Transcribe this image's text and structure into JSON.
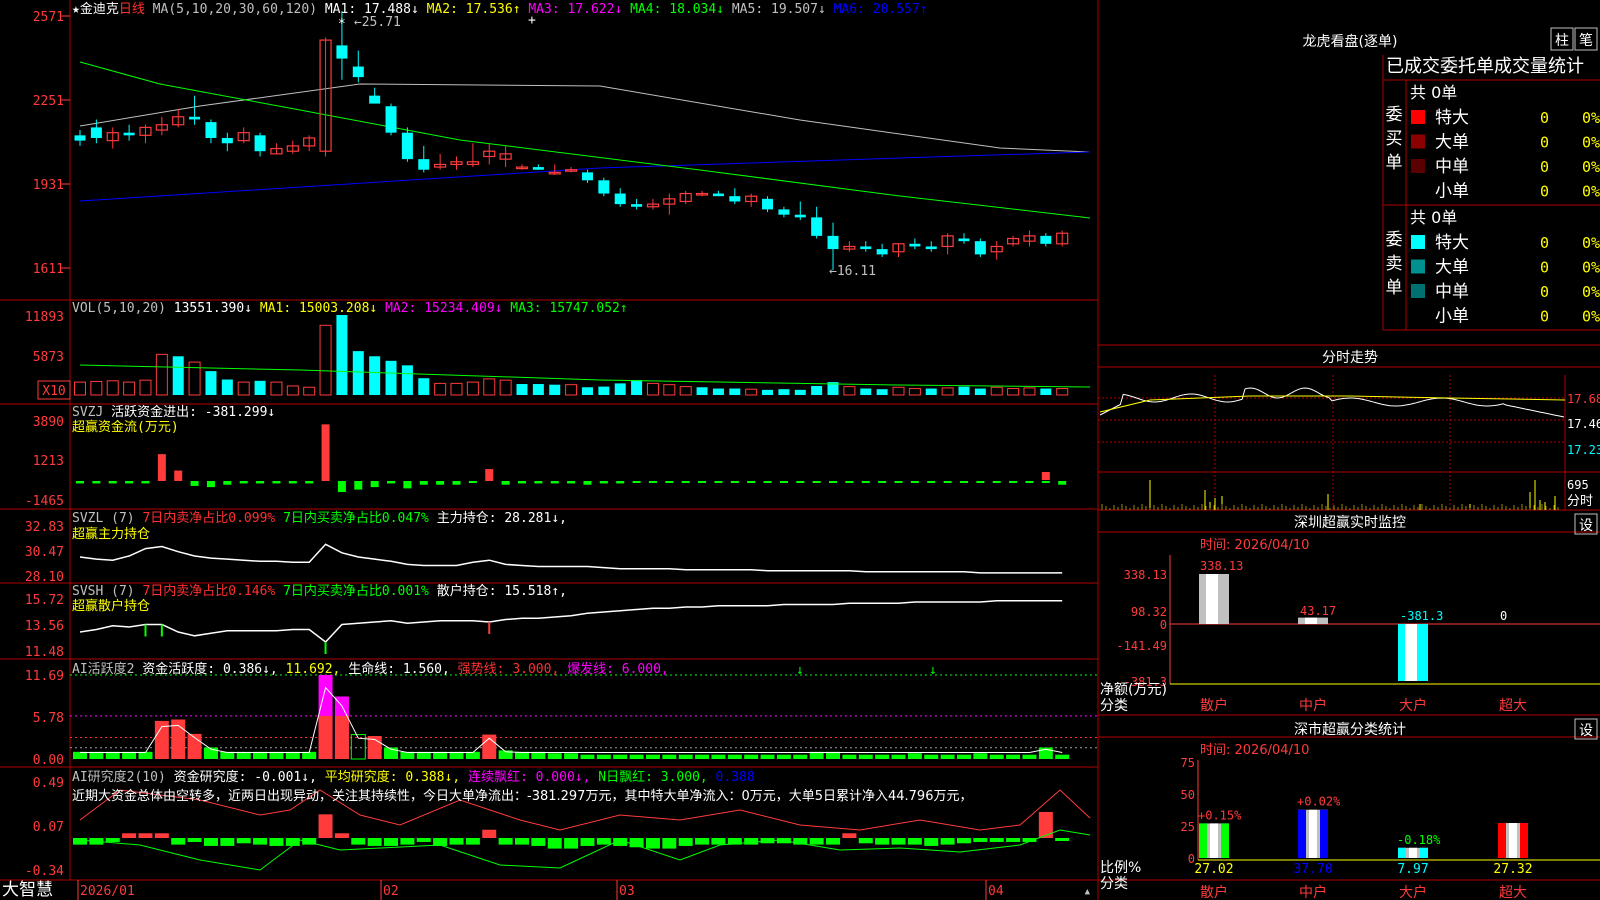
{
  "app": {
    "brand": "大智慧",
    "ai_commentary": "近期大资金总体由空转多，近两日出现异动，关注其持续性，今日大单净流出：-381.297万元，其中特大单净流入：0万元，大单5日累计净入44.796万元，"
  },
  "colors": {
    "up": "#ff3b3b",
    "down": "#00ffff",
    "bg": "#000000",
    "frame": "#b00000",
    "text": "#c0c0c0",
    "ma1": "#ffffff",
    "ma2": "#ffff00",
    "ma3": "#ff00ff",
    "ma4": "#00ff00",
    "ma5": "#c0c0c0",
    "ma6": "#0000ff",
    "green": "#00ff00",
    "yellow": "#ffff00",
    "magenta": "#ff00ff",
    "red": "#ff3030",
    "gray": "#c0c0c0"
  },
  "headers": {
    "kline": [
      {
        "text": "★金迪克",
        "c": "#ffffff"
      },
      {
        "text": "日线",
        "c": "#ff3030"
      },
      {
        "text": " MA(5,10,20,30,60,120)",
        "c": "#c0c0c0"
      },
      {
        "text": " MA1: 17.488↓",
        "c": "#ffffff"
      },
      {
        "text": " MA2: 17.536↑",
        "c": "#ffff00"
      },
      {
        "text": " MA3: 17.622↓",
        "c": "#ff00ff"
      },
      {
        "text": " MA4: 18.034↓",
        "c": "#00ff00"
      },
      {
        "text": " MA5: 19.507↓",
        "c": "#c0c0c0"
      },
      {
        "text": " MA6: 20.557↑",
        "c": "#0000ff"
      }
    ],
    "vol": [
      {
        "text": "VOL(5,10,20)",
        "c": "#c0c0c0"
      },
      {
        "text": " 13551.390↓",
        "c": "#ffffff"
      },
      {
        "text": " MA1: 15003.208↓",
        "c": "#ffff00"
      },
      {
        "text": " MA2: 15234.409↓",
        "c": "#ff00ff"
      },
      {
        "text": " MA3: 15747.052↑",
        "c": "#00ff00"
      }
    ],
    "svzj": [
      {
        "text": "SVZJ",
        "c": "#c0c0c0"
      },
      {
        "text": "  活跃资金进出: -381.299↓",
        "c": "#ffffff"
      }
    ],
    "svzj2": [
      {
        "text": "超赢资金流(万元)",
        "c": "#ffff00"
      }
    ],
    "svzl": [
      {
        "text": "SVZL (7)",
        "c": "#c0c0c0"
      },
      {
        "text": " 7日内卖净占比0.099%",
        "c": "#ff3030"
      },
      {
        "text": " 7日内买卖净占比0.047%",
        "c": "#00ff00"
      },
      {
        "text": " 主力持仓: 28.281↓,",
        "c": "#ffffff"
      }
    ],
    "svzl2": [
      {
        "text": "超赢主力持仓",
        "c": "#ffff00"
      }
    ],
    "svsh": [
      {
        "text": "SVSH (7)",
        "c": "#c0c0c0"
      },
      {
        "text": " 7日内卖净占比0.146%",
        "c": "#ff3030"
      },
      {
        "text": " 7日内买卖净占比0.001%",
        "c": "#00ff00"
      },
      {
        "text": " 散户持仓: 15.518↑,",
        "c": "#ffffff"
      }
    ],
    "svsh2": [
      {
        "text": "超赢散户持仓",
        "c": "#ffff00"
      }
    ],
    "ai1": [
      {
        "text": "AI活跃度2",
        "c": "#c0c0c0"
      },
      {
        "text": " 资金活跃度: 0.386↓,",
        "c": "#ffffff"
      },
      {
        "text": " 11.692,",
        "c": "#ffff00"
      },
      {
        "text": " 生命线: 1.560,",
        "c": "#ffffff"
      },
      {
        "text": " 强势线: 3.000,",
        "c": "#ff3030"
      },
      {
        "text": " 爆发线: 6.000,",
        "c": "#ff00ff"
      }
    ],
    "ai2": [
      {
        "text": "AI研究度2(10)",
        "c": "#c0c0c0"
      },
      {
        "text": " 资金研究度: -0.001↓,",
        "c": "#ffffff"
      },
      {
        "text": " 平均研究度: 0.388↓,",
        "c": "#ffff00"
      },
      {
        "text": " 连续飘红: 0.000↓,",
        "c": "#ff00ff"
      },
      {
        "text": " N日飘红: 3.000,",
        "c": "#00ff00"
      },
      {
        "text": " 0.388",
        "c": "#0000ff"
      }
    ]
  },
  "axes": {
    "kline": [
      "2571",
      "2251",
      "1931",
      "1611"
    ],
    "vol": [
      "11893",
      "5873"
    ],
    "vol_unit": "X10",
    "svzj": [
      "3890",
      "1213",
      "-1465"
    ],
    "svzl": [
      "32.83",
      "30.47",
      "28.10"
    ],
    "svsh": [
      "15.72",
      "13.56",
      "11.48"
    ],
    "ai1": [
      "11.69",
      "5.78",
      "0.00"
    ],
    "ai2": [
      "0.49",
      "0.07",
      "-0.34"
    ],
    "dates": [
      "2026/01",
      "02",
      "03",
      "04"
    ],
    "intraday_right": [
      "17.68",
      "17.46",
      "17.23",
      "695"
    ],
    "intraday_right_last": "分时"
  },
  "kline_labels": {
    "high": "25.71",
    "low": "16.11"
  },
  "right_panel": {
    "longhu_title": "龙虎看盘(逐单)",
    "btn_zhu": "柱",
    "btn_bi": "笔",
    "tabs_line": "已成交委托单成交量统计",
    "buy_group": {
      "title": "委买单",
      "total": "共 0单",
      "rows": [
        {
          "label": "特大",
          "v": "0",
          "p": "0%",
          "c": "#ff0000"
        },
        {
          "label": "大单",
          "v": "0",
          "p": "0%",
          "c": "#8b0000"
        },
        {
          "label": "中单",
          "v": "0",
          "p": "0%",
          "c": "#5a0000"
        },
        {
          "label": "小单",
          "v": "0",
          "p": "0%",
          "c": ""
        }
      ]
    },
    "sell_group": {
      "title": "委卖单",
      "total": "共 0单",
      "rows": [
        {
          "label": "特大",
          "v": "0",
          "p": "0%",
          "c": "#00ffff"
        },
        {
          "label": "大单",
          "v": "0",
          "p": "0%",
          "c": "#009090"
        },
        {
          "label": "中单",
          "v": "0",
          "p": "0%",
          "c": "#007070"
        },
        {
          "label": "小单",
          "v": "0",
          "p": "0%",
          "c": ""
        }
      ]
    },
    "intraday_title": "分时走势",
    "monitor_title": "深圳超赢实时监控",
    "monitor_btn": "设",
    "monitor_time": "时间: 2026/04/10",
    "monitor_axis": [
      "338.13",
      "98.32",
      "0",
      "-141.49",
      "-381.3"
    ],
    "monitor_labels": [
      "338.13",
      "43.17",
      "-381.3",
      "0"
    ],
    "monitor_ylabel": "净额(万元)",
    "monitor_xlabel": "分类",
    "monitor_cats": [
      "散户",
      "中户",
      "大户",
      "超大"
    ],
    "class_title": "深市超赢分类统计",
    "class_btn": "设",
    "class_time": "时间: 2026/04/10",
    "class_axis": [
      "75",
      "50",
      "25",
      "0"
    ],
    "class_top": [
      "+0.15%",
      "+0.02%",
      "-0.18%",
      ""
    ],
    "class_bottom": [
      "27.02",
      "37.70",
      "7.97",
      "27.32"
    ],
    "class_ylabel": "比例%",
    "class_xlabel": "分类",
    "class_cats": [
      "散户",
      "中户",
      "大户",
      "超大"
    ]
  },
  "chart_data": [
    {
      "type": "candlestick",
      "title": "金迪克 日线",
      "y_ticks": [
        25.71,
        22.51,
        19.31,
        16.11
      ],
      "high_label": 25.71,
      "low_label": 16.11,
      "ohlc": [
        [
          21.2,
          21.4,
          20.8,
          21.0
        ],
        [
          21.5,
          21.8,
          20.9,
          21.1
        ],
        [
          21.0,
          21.5,
          20.7,
          21.3
        ],
        [
          21.3,
          21.6,
          21.0,
          21.2
        ],
        [
          21.2,
          21.6,
          20.9,
          21.5
        ],
        [
          21.4,
          21.9,
          21.2,
          21.6
        ],
        [
          21.6,
          22.2,
          21.5,
          21.9
        ],
        [
          21.9,
          22.7,
          21.6,
          21.8
        ],
        [
          21.7,
          21.8,
          20.9,
          21.1
        ],
        [
          21.1,
          21.3,
          20.6,
          20.9
        ],
        [
          21.0,
          21.5,
          20.9,
          21.3
        ],
        [
          21.2,
          21.3,
          20.4,
          20.6
        ],
        [
          20.5,
          20.9,
          20.5,
          20.7
        ],
        [
          20.6,
          21.0,
          20.5,
          20.8
        ],
        [
          20.8,
          21.2,
          20.6,
          21.1
        ],
        [
          20.6,
          24.9,
          20.4,
          24.8
        ],
        [
          24.6,
          25.9,
          23.3,
          24.1
        ],
        [
          23.8,
          24.4,
          23.2,
          23.4
        ],
        [
          22.7,
          23.0,
          22.4,
          22.4
        ],
        [
          22.3,
          22.4,
          21.2,
          21.3
        ],
        [
          21.3,
          21.5,
          20.2,
          20.3
        ],
        [
          20.3,
          20.8,
          19.8,
          19.9
        ],
        [
          20.0,
          20.5,
          19.9,
          20.1
        ],
        [
          20.1,
          20.4,
          19.9,
          20.2
        ],
        [
          20.1,
          20.9,
          20.0,
          20.2
        ],
        [
          20.4,
          20.9,
          20.1,
          20.6
        ],
        [
          20.3,
          20.8,
          20.0,
          20.5
        ],
        [
          20.0,
          20.1,
          19.9,
          20.0
        ],
        [
          20.0,
          20.1,
          19.9,
          19.9
        ],
        [
          19.8,
          20.1,
          19.7,
          19.8
        ],
        [
          19.9,
          20.0,
          19.8,
          19.9
        ],
        [
          19.8,
          19.9,
          19.4,
          19.5
        ],
        [
          19.5,
          19.6,
          18.9,
          19.0
        ],
        [
          19.0,
          19.2,
          18.5,
          18.6
        ],
        [
          18.6,
          18.8,
          18.4,
          18.5
        ],
        [
          18.5,
          18.8,
          18.4,
          18.6
        ],
        [
          18.6,
          19.0,
          18.2,
          18.8
        ],
        [
          18.7,
          19.1,
          18.6,
          19.0
        ],
        [
          19.0,
          19.1,
          18.9,
          19.0
        ],
        [
          19.0,
          19.1,
          18.9,
          18.9
        ],
        [
          18.9,
          19.2,
          18.6,
          18.7
        ],
        [
          18.7,
          19.0,
          18.5,
          18.9
        ],
        [
          18.8,
          18.9,
          18.3,
          18.4
        ],
        [
          18.4,
          18.5,
          18.1,
          18.2
        ],
        [
          18.2,
          18.7,
          18.0,
          18.1
        ],
        [
          18.1,
          18.5,
          17.3,
          17.4
        ],
        [
          17.4,
          17.9,
          16.1,
          16.9
        ],
        [
          16.9,
          17.2,
          16.8,
          17.0
        ],
        [
          17.0,
          17.2,
          16.8,
          16.9
        ],
        [
          16.9,
          17.1,
          16.6,
          16.7
        ],
        [
          16.8,
          17.1,
          16.6,
          17.1
        ],
        [
          17.1,
          17.3,
          16.9,
          17.0
        ],
        [
          17.0,
          17.2,
          16.8,
          16.9
        ],
        [
          17.0,
          17.5,
          16.7,
          17.4
        ],
        [
          17.3,
          17.5,
          17.1,
          17.2
        ],
        [
          17.2,
          17.3,
          16.6,
          16.7
        ],
        [
          16.8,
          17.2,
          16.5,
          17.0
        ],
        [
          17.1,
          17.4,
          17.0,
          17.3
        ],
        [
          17.2,
          17.6,
          17.0,
          17.4
        ],
        [
          17.4,
          17.5,
          17.0,
          17.1
        ],
        [
          17.1,
          17.6,
          17.0,
          17.5
        ]
      ]
    },
    {
      "type": "bar",
      "title": "VOL(5,10,20)",
      "unit": "X10",
      "y_ticks": [
        11893,
        5873
      ],
      "values": [
        2000,
        2100,
        2200,
        2000,
        2300,
        6300,
        6000,
        5100,
        3700,
        2400,
        2000,
        2200,
        2000,
        1400,
        1200,
        10800,
        12400,
        6800,
        6000,
        5300,
        4600,
        2600,
        1800,
        1800,
        2000,
        2500,
        2300,
        1700,
        1700,
        1600,
        1600,
        1200,
        1300,
        1800,
        2300,
        1800,
        1600,
        1300,
        1200,
        1000,
        1000,
        900,
        800,
        900,
        800,
        1400,
        2000,
        1300,
        1000,
        900,
        1200,
        1000,
        1000,
        1100,
        1300,
        1000,
        1200,
        1000,
        1100,
        1000,
        1000
      ],
      "up": [
        1,
        1,
        1,
        1,
        1,
        1,
        0,
        1,
        0,
        0,
        1,
        0,
        1,
        1,
        1,
        1,
        0,
        0,
        0,
        0,
        0,
        0,
        1,
        1,
        1,
        1,
        1,
        0,
        0,
        0,
        1,
        0,
        0,
        0,
        0,
        1,
        1,
        1,
        0,
        0,
        0,
        1,
        0,
        0,
        0,
        0,
        0,
        1,
        0,
        0,
        1,
        1,
        0,
        1,
        0,
        0,
        1,
        1,
        1,
        0,
        1
      ]
    },
    {
      "type": "bar",
      "title": "超赢资金流(万元)",
      "y_ticks": [
        3890,
        1213,
        -1465
      ],
      "values": [
        -200,
        -200,
        -200,
        -200,
        -200,
        1800,
        700,
        -400,
        -500,
        -300,
        -200,
        -200,
        -200,
        -200,
        -200,
        3800,
        -900,
        -700,
        -500,
        -200,
        -600,
        -300,
        -300,
        -300,
        -100,
        800,
        -300,
        -200,
        -200,
        -200,
        -200,
        -300,
        -200,
        -200,
        -100,
        -100,
        -100,
        -100,
        -100,
        -100,
        -100,
        -100,
        -100,
        -100,
        -100,
        -100,
        -100,
        -100,
        -100,
        -100,
        -100,
        -100,
        -100,
        -100,
        -100,
        -100,
        -100,
        -100,
        -100,
        -100,
        -300
      ],
      "last_red": 400
    },
    {
      "type": "line",
      "title": "超赢主力持仓",
      "y_ticks": [
        32.83,
        30.47,
        28.1
      ],
      "values": [
        29.8,
        29.6,
        29.5,
        29.9,
        30.6,
        30.8,
        30.3,
        29.9,
        29.7,
        29.6,
        29.5,
        29.4,
        29.4,
        29.3,
        29.3,
        31.0,
        30.2,
        29.8,
        29.6,
        29.4,
        29.1,
        29.0,
        29.0,
        29.0,
        29.3,
        29.5,
        29.1,
        29.0,
        28.9,
        28.9,
        28.9,
        28.9,
        28.8,
        28.7,
        28.7,
        28.7,
        28.7,
        28.6,
        28.6,
        28.6,
        28.6,
        28.6,
        28.5,
        28.5,
        28.5,
        28.5,
        28.5,
        28.5,
        28.4,
        28.4,
        28.4,
        28.4,
        28.4,
        28.4,
        28.4,
        28.3,
        28.3,
        28.3,
        28.3,
        28.3,
        28.3
      ]
    },
    {
      "type": "line",
      "title": "超赢散户持仓",
      "y_ticks": [
        15.72,
        13.56,
        11.48
      ],
      "values": [
        13.0,
        13.2,
        13.5,
        13.4,
        13.6,
        13.6,
        13.0,
        12.7,
        12.9,
        13.1,
        13.1,
        13.1,
        13.1,
        13.2,
        13.2,
        12.2,
        13.6,
        13.7,
        13.8,
        13.9,
        13.7,
        13.8,
        13.9,
        13.9,
        13.9,
        13.8,
        14.0,
        14.1,
        14.1,
        14.2,
        14.3,
        14.5,
        14.6,
        14.7,
        14.8,
        14.9,
        14.9,
        15.0,
        15.0,
        15.1,
        15.1,
        15.1,
        15.1,
        15.2,
        15.2,
        15.2,
        15.2,
        15.3,
        15.3,
        15.3,
        15.3,
        15.4,
        15.4,
        15.4,
        15.4,
        15.4,
        15.5,
        15.5,
        15.5,
        15.5,
        15.5
      ]
    },
    {
      "type": "bar",
      "title": "AI活跃度2",
      "y_ticks": [
        11.69,
        5.78,
        0.0
      ],
      "values": [
        1.0,
        1.0,
        1.0,
        1.0,
        1.0,
        5.3,
        5.5,
        3.5,
        1.6,
        1.0,
        1.0,
        1.0,
        1.0,
        1.0,
        1.0,
        11.7,
        8.7,
        3.4,
        3.2,
        1.6,
        1.0,
        1.0,
        1.0,
        1.0,
        1.0,
        3.4,
        1.2,
        1.0,
        1.0,
        0.8,
        0.8,
        0.6,
        0.6,
        0.6,
        0.6,
        0.6,
        0.6,
        0.6,
        0.6,
        0.6,
        0.6,
        0.6,
        0.6,
        0.6,
        0.6,
        1.0,
        1.0,
        0.6,
        0.6,
        0.6,
        0.6,
        0.8,
        0.6,
        0.6,
        0.6,
        0.8,
        0.6,
        0.6,
        0.6,
        1.6,
        0.6
      ],
      "lines": {
        "red": 3.0,
        "magenta": 6.0,
        "green": 11.69
      }
    },
    {
      "type": "bar",
      "title": "AI研究度2(10)",
      "y_ticks": [
        0.49,
        0.07,
        -0.34
      ],
      "values": [
        -0.05,
        -0.05,
        -0.03,
        0.04,
        0.04,
        0.04,
        -0.05,
        -0.03,
        -0.06,
        -0.06,
        -0.04,
        -0.05,
        -0.06,
        -0.06,
        -0.05,
        0.2,
        0.04,
        -0.05,
        -0.06,
        -0.06,
        -0.05,
        -0.03,
        -0.06,
        -0.05,
        -0.05,
        0.07,
        -0.05,
        -0.05,
        -0.06,
        -0.08,
        -0.08,
        -0.06,
        -0.05,
        -0.06,
        -0.07,
        -0.08,
        -0.08,
        -0.06,
        -0.05,
        -0.05,
        -0.05,
        -0.05,
        -0.04,
        -0.04,
        -0.05,
        -0.05,
        -0.05,
        0.04,
        -0.04,
        -0.05,
        -0.05,
        -0.05,
        -0.06,
        -0.05,
        -0.04,
        -0.03,
        -0.03,
        -0.03,
        -0.03,
        0.22,
        -0.001
      ]
    },
    {
      "type": "line",
      "title": "分时走势",
      "y_ticks": [
        17.68,
        17.46,
        17.23
      ],
      "vol_tick": 695
    },
    {
      "type": "bar",
      "title": "深圳超赢实时监控",
      "categories": [
        "散户",
        "中户",
        "大户",
        "超大"
      ],
      "values": [
        338.13,
        43.17,
        -381.3,
        0
      ],
      "y_ticks": [
        338.13,
        98.32,
        0,
        -141.49,
        -381.3
      ]
    },
    {
      "type": "bar",
      "title": "深市超赢分类统计",
      "categories": [
        "散户",
        "中户",
        "大户",
        "超大"
      ],
      "values": [
        27.02,
        37.7,
        7.97,
        27.32
      ],
      "changes": [
        "+0.15%",
        "+0.02%",
        "-0.18%",
        ""
      ],
      "y_ticks": [
        75,
        50,
        25,
        0
      ]
    }
  ]
}
